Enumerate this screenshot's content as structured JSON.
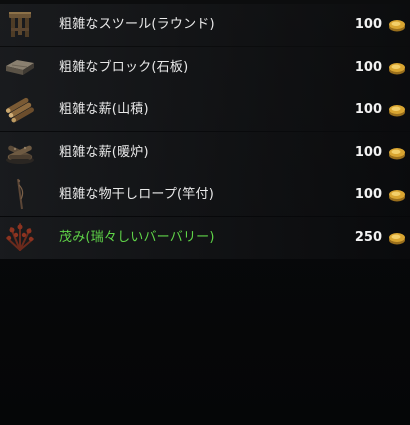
{
  "store": {
    "items": [
      {
        "name": "粗雑なスツール(ラウンド)",
        "price": "100",
        "icon": "stool-icon",
        "quality": "normal"
      },
      {
        "name": "粗雑なブロック(石板)",
        "price": "100",
        "icon": "stone-block-icon",
        "quality": "normal"
      },
      {
        "name": "粗雑な薪(山積)",
        "price": "100",
        "icon": "firewood-pile-icon",
        "quality": "normal"
      },
      {
        "name": "粗雑な薪(暖炉)",
        "price": "100",
        "icon": "fireplace-logs-icon",
        "quality": "normal"
      },
      {
        "name": "粗雑な物干しロープ(竿付)",
        "price": "100",
        "icon": "clothesline-icon",
        "quality": "normal"
      },
      {
        "name": "茂み(瑞々しいバーバリー)",
        "price": "250",
        "icon": "barberry-bush-icon",
        "quality": "fine"
      }
    ],
    "currency_icon": "gold-coin-icon",
    "colors": {
      "normal_text": "#e9e9e9",
      "fine_text": "#5fd448",
      "price_text": "#f2f2f2",
      "gold": "#d9a531"
    }
  }
}
